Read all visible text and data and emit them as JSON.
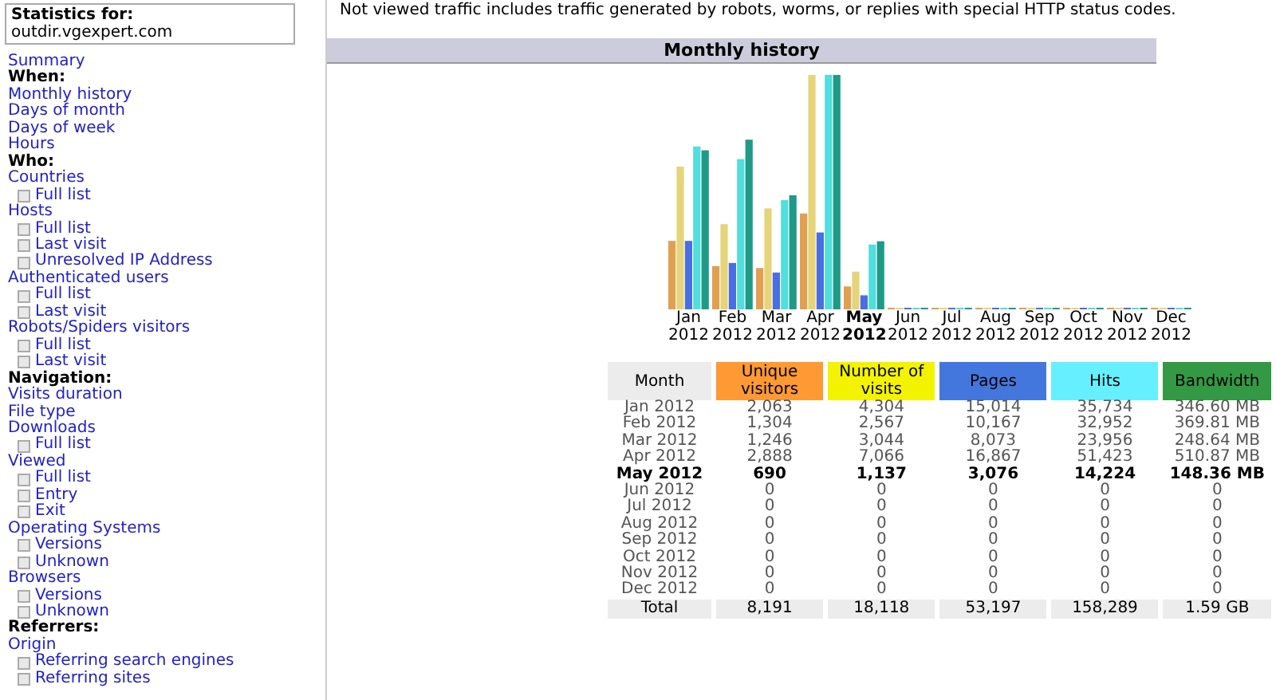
{
  "stats_box": {
    "label": "Statistics for:",
    "site": "outdir.vgexpert.com"
  },
  "menu": [
    {
      "kind": "link",
      "label": "Summary"
    },
    {
      "kind": "heading",
      "label": "When:"
    },
    {
      "kind": "link",
      "label": "Monthly history"
    },
    {
      "kind": "link",
      "label": "Days of month"
    },
    {
      "kind": "link",
      "label": "Days of week"
    },
    {
      "kind": "link",
      "label": "Hours"
    },
    {
      "kind": "heading",
      "label": "Who:"
    },
    {
      "kind": "link",
      "label": "Countries",
      "children": [
        {
          "label": "Full list"
        }
      ]
    },
    {
      "kind": "link",
      "label": "Hosts",
      "children": [
        {
          "label": "Full list"
        },
        {
          "label": "Last visit"
        },
        {
          "label": "Unresolved IP Address"
        }
      ]
    },
    {
      "kind": "link",
      "label": "Authenticated users",
      "children": [
        {
          "label": "Full list"
        },
        {
          "label": "Last visit"
        }
      ]
    },
    {
      "kind": "link",
      "label": "Robots/Spiders visitors",
      "children": [
        {
          "label": "Full list"
        },
        {
          "label": "Last visit"
        }
      ]
    },
    {
      "kind": "heading",
      "label": "Navigation:"
    },
    {
      "kind": "link",
      "label": "Visits duration"
    },
    {
      "kind": "link",
      "label": "File type"
    },
    {
      "kind": "link",
      "label": "Downloads",
      "children": [
        {
          "label": "Full list"
        }
      ]
    },
    {
      "kind": "link",
      "label": "Viewed",
      "children": [
        {
          "label": "Full list"
        },
        {
          "label": "Entry"
        },
        {
          "label": "Exit"
        }
      ]
    },
    {
      "kind": "link",
      "label": "Operating Systems",
      "children": [
        {
          "label": "Versions"
        },
        {
          "label": "Unknown"
        }
      ]
    },
    {
      "kind": "link",
      "label": "Browsers",
      "children": [
        {
          "label": "Versions"
        },
        {
          "label": "Unknown"
        }
      ]
    },
    {
      "kind": "heading",
      "label": "Referrers:"
    },
    {
      "kind": "link",
      "label": "Origin",
      "children": [
        {
          "label": "Referring search engines"
        },
        {
          "label": "Referring sites"
        }
      ]
    }
  ],
  "note": "Not viewed traffic includes traffic generated by robots, worms, or replies with special HTTP status codes.",
  "section_title": "Monthly history",
  "chart_labels": [
    {
      "month": "Jan",
      "year": "2012",
      "current": false
    },
    {
      "month": "Feb",
      "year": "2012",
      "current": false
    },
    {
      "month": "Mar",
      "year": "2012",
      "current": false
    },
    {
      "month": "Apr",
      "year": "2012",
      "current": false
    },
    {
      "month": "May",
      "year": "2012",
      "current": true
    },
    {
      "month": "Jun",
      "year": "2012",
      "current": false
    },
    {
      "month": "Jul",
      "year": "2012",
      "current": false
    },
    {
      "month": "Aug",
      "year": "2012",
      "current": false
    },
    {
      "month": "Sep",
      "year": "2012",
      "current": false
    },
    {
      "month": "Oct",
      "year": "2012",
      "current": false
    },
    {
      "month": "Nov",
      "year": "2012",
      "current": false
    },
    {
      "month": "Dec",
      "year": "2012",
      "current": false
    }
  ],
  "table": {
    "columns": [
      {
        "label": "Month",
        "color": "#ececec"
      },
      {
        "label": "Unique visitors",
        "color": "#ff9933"
      },
      {
        "label": "Number of visits",
        "color": "#f3f300"
      },
      {
        "label": "Pages",
        "color": "#4477dd"
      },
      {
        "label": "Hits",
        "color": "#66f0ff"
      },
      {
        "label": "Bandwidth",
        "color": "#339944"
      }
    ],
    "rows": [
      {
        "cells": [
          "Jan 2012",
          "2,063",
          "4,304",
          "15,014",
          "35,734",
          "346.60 MB"
        ],
        "current": false
      },
      {
        "cells": [
          "Feb 2012",
          "1,304",
          "2,567",
          "10,167",
          "32,952",
          "369.81 MB"
        ],
        "current": false
      },
      {
        "cells": [
          "Mar 2012",
          "1,246",
          "3,044",
          "8,073",
          "23,956",
          "248.64 MB"
        ],
        "current": false
      },
      {
        "cells": [
          "Apr 2012",
          "2,888",
          "7,066",
          "16,867",
          "51,423",
          "510.87 MB"
        ],
        "current": false
      },
      {
        "cells": [
          "May 2012",
          "690",
          "1,137",
          "3,076",
          "14,224",
          "148.36 MB"
        ],
        "current": true
      },
      {
        "cells": [
          "Jun 2012",
          "0",
          "0",
          "0",
          "0",
          "0"
        ],
        "current": false
      },
      {
        "cells": [
          "Jul 2012",
          "0",
          "0",
          "0",
          "0",
          "0"
        ],
        "current": false
      },
      {
        "cells": [
          "Aug 2012",
          "0",
          "0",
          "0",
          "0",
          "0"
        ],
        "current": false
      },
      {
        "cells": [
          "Sep 2012",
          "0",
          "0",
          "0",
          "0",
          "0"
        ],
        "current": false
      },
      {
        "cells": [
          "Oct 2012",
          "0",
          "0",
          "0",
          "0",
          "0"
        ],
        "current": false
      },
      {
        "cells": [
          "Nov 2012",
          "0",
          "0",
          "0",
          "0",
          "0"
        ],
        "current": false
      },
      {
        "cells": [
          "Dec 2012",
          "0",
          "0",
          "0",
          "0",
          "0"
        ],
        "current": false
      }
    ],
    "total": [
      "Total",
      "8,191",
      "18,118",
      "53,197",
      "158,289",
      "1.59 GB"
    ]
  }
}
